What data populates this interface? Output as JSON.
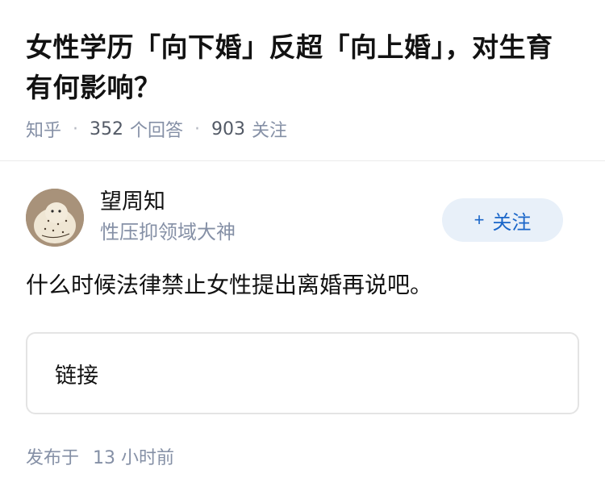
{
  "question": {
    "title": "女性学历「向下婚」反超「向上婚」，对生育有何影响？",
    "source": "知乎",
    "answer_count": "352",
    "answer_label": "个回答",
    "follower_count": "903",
    "follower_label": "关注"
  },
  "author": {
    "name": "望周知",
    "bio": "性压抑领域大神",
    "follow_label": "关注",
    "follow_icon": "plus-icon"
  },
  "answer": {
    "content": "什么时候法律禁止女性提出离婚再说吧。",
    "link_label": "链接",
    "published_prefix": "发布于",
    "published_time": "13 小时前"
  },
  "colors": {
    "accent": "#1a66c9",
    "accent_bg": "#e8f0f9",
    "meta": "#8590a6"
  }
}
